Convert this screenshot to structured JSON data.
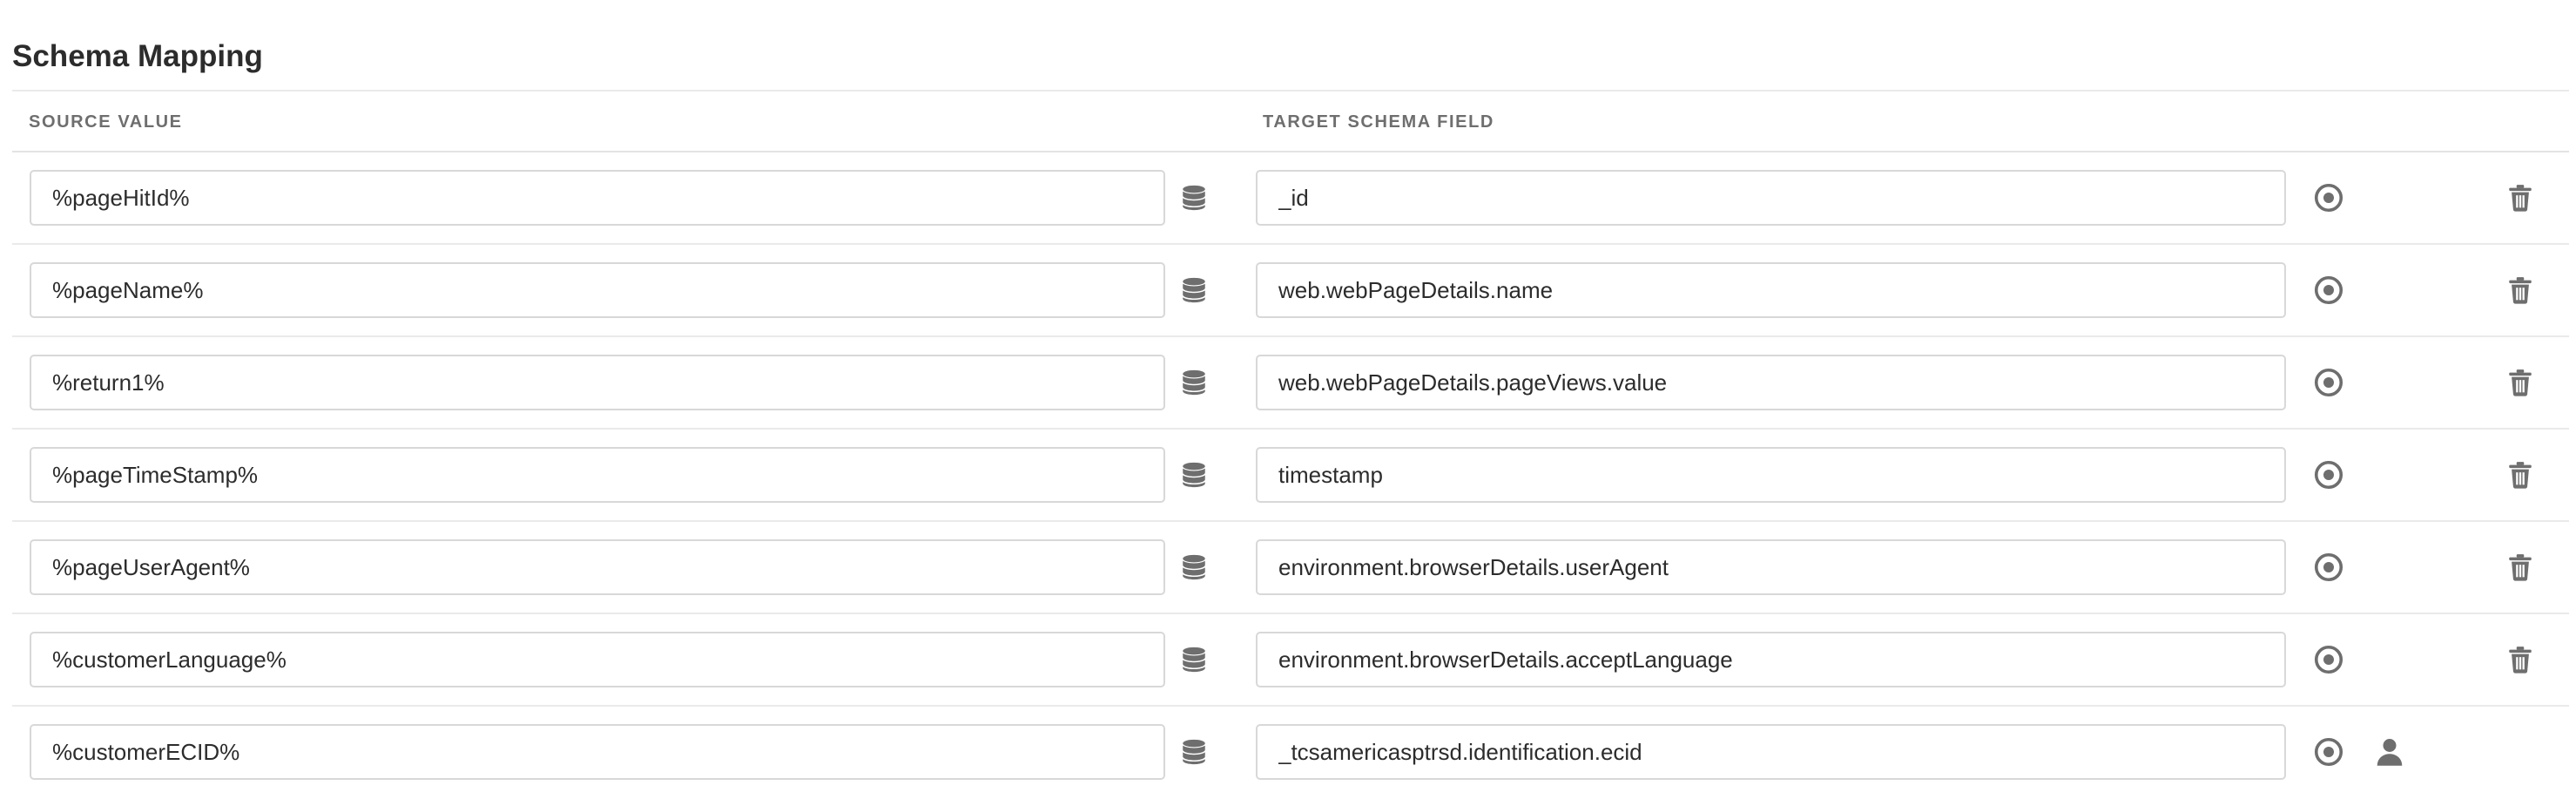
{
  "page": {
    "title": "Schema Mapping"
  },
  "columns": {
    "source": "SOURCE VALUE",
    "target": "TARGET SCHEMA FIELD"
  },
  "icons": {
    "source_select": "database-icon",
    "target_select": "target-icon",
    "delete": "trash-icon",
    "identity": "user-icon"
  },
  "colors": {
    "icon": "#6e6e6e",
    "border": "#d8d8d8",
    "text": "#2c2c2c"
  },
  "rows": [
    {
      "source": "%pageHitId%",
      "target": "_id",
      "action": "delete"
    },
    {
      "source": "%pageName%",
      "target": "web.webPageDetails.name",
      "action": "delete"
    },
    {
      "source": "%return1%",
      "target": "web.webPageDetails.pageViews.value",
      "action": "delete"
    },
    {
      "source": "%pageTimeStamp%",
      "target": "timestamp",
      "action": "delete"
    },
    {
      "source": "%pageUserAgent%",
      "target": "environment.browserDetails.userAgent",
      "action": "delete"
    },
    {
      "source": "%customerLanguage%",
      "target": "environment.browserDetails.acceptLanguage",
      "action": "delete"
    },
    {
      "source": "%customerECID%",
      "target": "_tcsamericasptrsd.identification.ecid",
      "action": "identity"
    }
  ]
}
